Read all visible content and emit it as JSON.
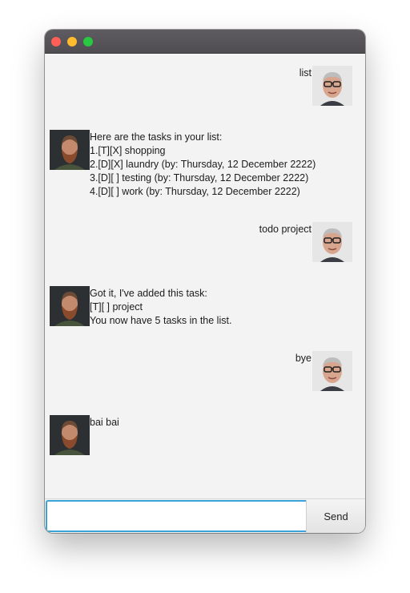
{
  "window": {
    "buttons": [
      "close",
      "minimize",
      "maximize"
    ]
  },
  "messages": [
    {
      "from": "user",
      "lines": [
        "list"
      ],
      "avatar": "user-avatar"
    },
    {
      "from": "bot",
      "lines": [
        "Here are the tasks in your list:",
        "1.[T][X] shopping",
        "2.[D][X] laundry (by: Thursday, 12 December 2222)",
        "3.[D][ ] testing (by: Thursday, 12 December 2222)",
        "4.[D][ ] work (by: Thursday, 12 December 2222)"
      ],
      "avatar": "bot-avatar"
    },
    {
      "from": "user",
      "lines": [
        "todo project"
      ],
      "avatar": "user-avatar"
    },
    {
      "from": "bot",
      "lines": [
        "Got it, I've added this task:",
        "[T][ ] project",
        "You now have 5 tasks in the list."
      ],
      "avatar": "bot-avatar"
    },
    {
      "from": "user",
      "lines": [
        "bye"
      ],
      "avatar": "user-avatar"
    },
    {
      "from": "bot",
      "lines": [
        "bai bai"
      ],
      "avatar": "bot-avatar"
    }
  ],
  "input": {
    "value": "",
    "placeholder": ""
  },
  "send_label": "Send",
  "colors": {
    "close": "#ff5f57",
    "minimize": "#febc2e",
    "maximize": "#28c840",
    "input_focus": "#3ba3d6",
    "background": "#f3f3f3"
  }
}
